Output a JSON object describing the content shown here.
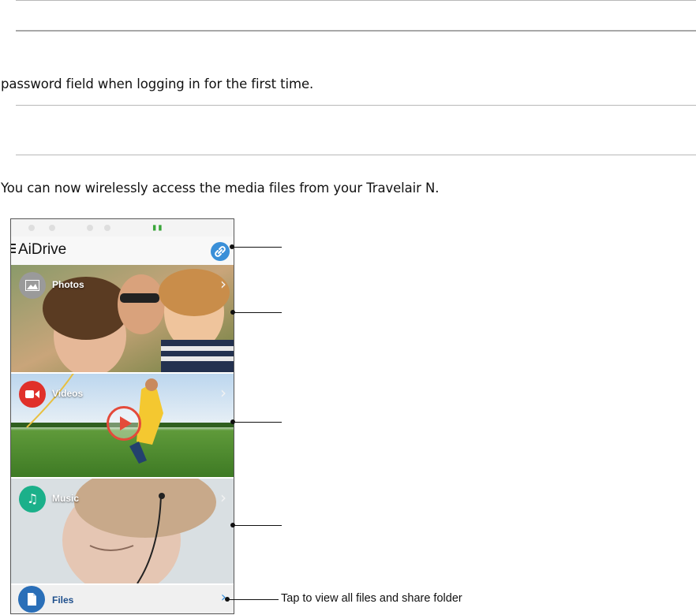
{
  "document": {
    "paragraph_1": "password field when logging in for the first time.",
    "paragraph_2": "You can now wirelessly access the media files from your Travelair N."
  },
  "app": {
    "title": "AiDrive",
    "tiles": [
      {
        "label": "Photos",
        "icon": "image-icon"
      },
      {
        "label": "Videos",
        "icon": "video-camera-icon"
      },
      {
        "label": "Music",
        "icon": "music-note-icon"
      },
      {
        "label": "Files",
        "icon": "file-icon"
      }
    ]
  },
  "callouts": {
    "files": "Tap to view all files and share folder"
  },
  "colors": {
    "link_button": "#3a8fd8",
    "videos_icon": "#e0302a",
    "music_icon": "#1bb08a",
    "files_icon": "#2a6fb8",
    "signal": "#3aa63a"
  }
}
